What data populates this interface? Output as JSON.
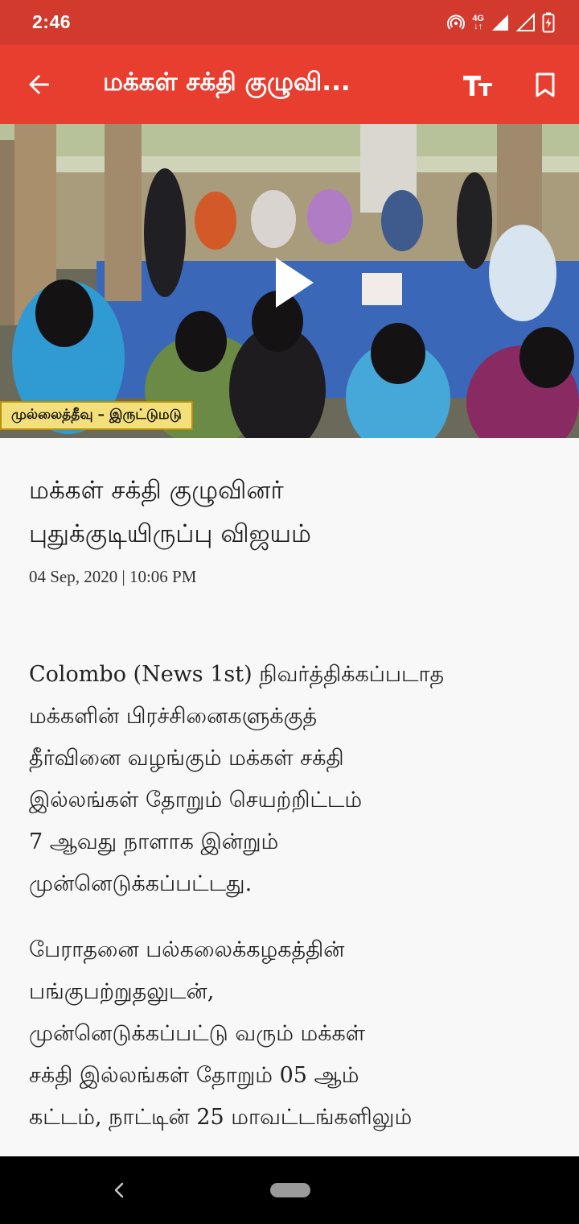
{
  "status_bar": {
    "time": "2:46",
    "network": "4G",
    "icons": [
      "hotspot-icon",
      "network-4g-icon",
      "signal-icon",
      "signal-icon",
      "battery-charging-icon"
    ]
  },
  "app_bar": {
    "title": "மக்கள் சக்தி குழுவி...",
    "back_icon": "arrow-back-icon",
    "font_icon": "text-size-icon",
    "bookmark_icon": "bookmark-icon",
    "color": "#e83e30"
  },
  "video": {
    "caption": "முல்லைத்தீவு – இருட்டுமடு",
    "play_icon": "play-icon"
  },
  "article": {
    "headline_line1": "மக்கள் சக்தி குழுவினர்",
    "headline_line2": "புதுக்குடியிருப்பு விஜயம்",
    "date": "04 Sep, 2020 | 10:06 PM",
    "para1_lines": [
      "Colombo (News 1st) நிவர்த்திக்கப்படாத",
      "மக்களின் பிரச்சினைகளுக்குத்",
      "தீர்வினை வழங்கும் மக்கள் சக்தி",
      "இல்லங்கள் தோறும் செயற்றிட்டம்",
      "7 ஆவது நாளாக இன்றும்",
      "முன்னெடுக்கப்பட்டது."
    ],
    "para2_lines": [
      "பேராதனை பல்கலைக்கழகத்தின்",
      "பங்குபற்றுதலுடன்,",
      "முன்னெடுக்கப்பட்டு வரும் மக்கள்",
      "சக்தி இல்லங்கள் தோறும் 05 ஆம்",
      "கட்டம், நாட்டின் 25 மாவட்டங்களிலும்"
    ]
  },
  "nav_bar": {
    "back_icon": "nav-back-icon",
    "home_icon": "nav-home-pill"
  }
}
